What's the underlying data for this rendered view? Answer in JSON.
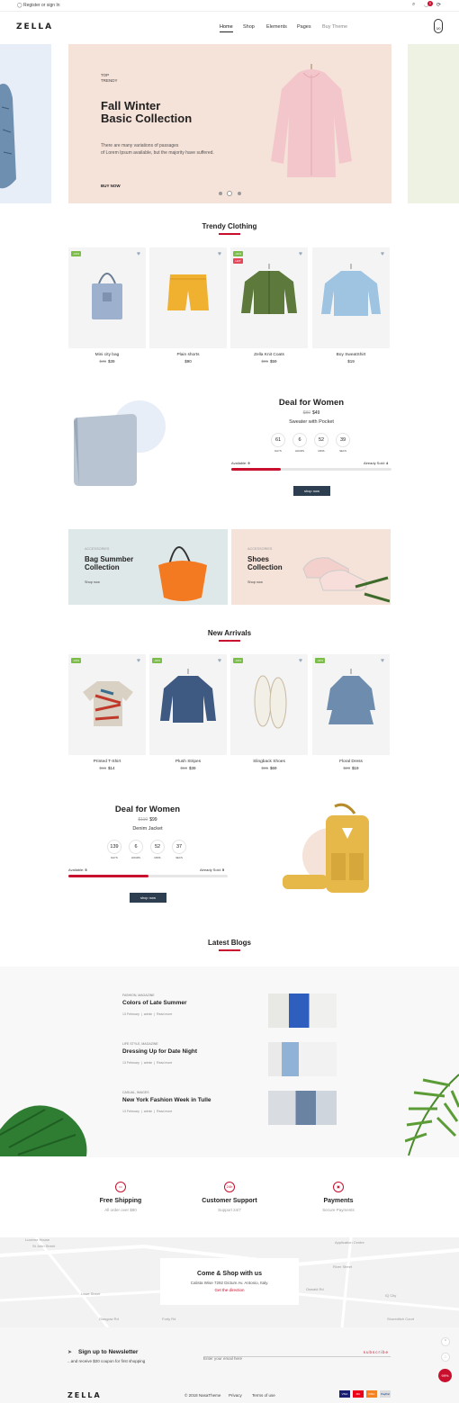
{
  "topbar": {
    "register": "Register or sign In",
    "cart_count": "0"
  },
  "header": {
    "logo": "ZELLA",
    "cart_label": "0/0",
    "nav": [
      "Home",
      "Shop",
      "Elements",
      "Pages",
      "Buy Theme"
    ]
  },
  "hero": {
    "tag_line1": "TOP",
    "tag_line2": "TRENDY",
    "title_line1": "Fall Winter",
    "title_line2": "Basic Collection",
    "desc_line1": "There are many variations of passages",
    "desc_line2": "of Lorem Ipsum available, but the majority have suffered.",
    "cta": "BUY NOW"
  },
  "trendy": {
    "title": "Trendy Clothing",
    "products": [
      {
        "name": "Mini city bag",
        "old": "$45",
        "price": "$39",
        "badge": "-13%",
        "badge2": ""
      },
      {
        "name": "Plain shorts",
        "old": "",
        "price": "$90",
        "badge": "",
        "badge2": ""
      },
      {
        "name": "Zella Knit Coats",
        "old": "$85",
        "price": "$59",
        "badge": "-31%",
        "badge2": "HOT"
      },
      {
        "name": "Boy SweatShirt",
        "old": "",
        "price": "$19",
        "badge": "",
        "badge2": ""
      }
    ]
  },
  "deal1": {
    "title": "Deal for Women",
    "old": "$80",
    "price": "$49",
    "product": "Sweater with Pocket",
    "countdown": [
      {
        "v": "61",
        "l": "DAYS"
      },
      {
        "v": "6",
        "l": "HOURS"
      },
      {
        "v": "52",
        "l": "MINS"
      },
      {
        "v": "39",
        "l": "SECS"
      }
    ],
    "available_label": "Available:",
    "available": "9",
    "sold_label": "Already Sold:",
    "sold": "4",
    "progress": 0.31,
    "button": "shop now"
  },
  "banners": [
    {
      "small": "ACCESSORIES",
      "line1": "Bag Summber",
      "line2": "Collection",
      "link": "Shop now"
    },
    {
      "small": "ACCESSORIES",
      "line1": "Shoes",
      "line2": "Collection",
      "link": "Shop now"
    }
  ],
  "arrivals": {
    "title": "New Arrivals",
    "products": [
      {
        "name": "Printed T-Shirt",
        "old": "$16",
        "price": "$14",
        "badge": "-13%"
      },
      {
        "name": "Plush Stripes",
        "old": "$50",
        "price": "$39",
        "badge": "-22%"
      },
      {
        "name": "Slingback Shoes",
        "old": "$85",
        "price": "$69",
        "badge": "-19%"
      },
      {
        "name": "Floral Dress",
        "old": "$28",
        "price": "$19",
        "badge": "-32%"
      }
    ]
  },
  "deal2": {
    "title": "Deal for Women",
    "old": "$110",
    "price": "$99",
    "product": "Denim Jacket",
    "countdown": [
      {
        "v": "139",
        "l": "DAYS"
      },
      {
        "v": "6",
        "l": "HOURS"
      },
      {
        "v": "52",
        "l": "MINS"
      },
      {
        "v": "37",
        "l": "SECS"
      }
    ],
    "available_label": "Available:",
    "available": "5",
    "sold_label": "Already Sold:",
    "sold": "5",
    "progress": 0.5,
    "button": "shop now"
  },
  "blogs": {
    "title": "Latest Blogs",
    "posts": [
      {
        "cat": "FASHION, MAGAZINE",
        "title": "Colors of Late Summer",
        "date": "13 February",
        "author": "admin",
        "more": "Read more"
      },
      {
        "cat": "LIFE STYLE, MAGAZINE",
        "title": "Dressing Up for Date Night",
        "date": "13 February",
        "author": "admin",
        "more": "Read more"
      },
      {
        "cat": "CASUAL, IMAGES",
        "title": "New York Fashion Week in Tulle",
        "date": "13 February",
        "author": "admin",
        "more": "Read more"
      }
    ]
  },
  "features": [
    {
      "title": "Free Shipping",
      "sub": "All order over $80",
      "icon": "truck-icon"
    },
    {
      "title": "Customer Support",
      "sub": "Support 24/7",
      "icon": "support-icon",
      "icon_text": "24h"
    },
    {
      "title": "Payments",
      "sub": "Secure Payments",
      "icon": "payment-icon"
    }
  ],
  "map": {
    "title": "Come & Shop with us",
    "address": "Calista Wise 7292 Dictum Av. Antonio, Italy.",
    "link": "Get the direction",
    "labels": [
      "Lucerne House",
      "St John Street",
      "Application Centre",
      "River Street",
      "Oswald Rd",
      "IQ City",
      "Shoreditch Court",
      "Lowe Street",
      "Glasgow Rd",
      "Forty Rd"
    ]
  },
  "newsletter": {
    "title": "Sign up to Newsletter",
    "sub": "...and receive $20 coupon for first shopping",
    "placeholder": "Enter your email here",
    "button": "subscribe"
  },
  "footer": {
    "logo": "ZELLA",
    "copyright": "© 2018 NasaTheme",
    "links": [
      "Privacy",
      "Terms of use"
    ],
    "payments": [
      "VISA",
      "MC",
      "DISC",
      "PayPal"
    ]
  },
  "floating": {
    "badge": "99%"
  }
}
